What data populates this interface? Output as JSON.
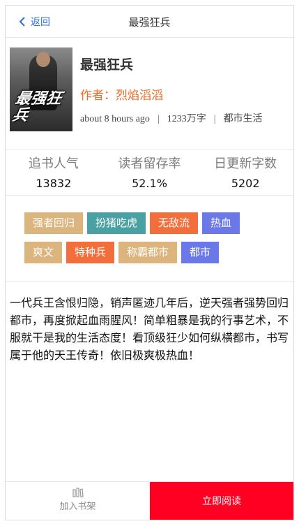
{
  "header": {
    "back_label": "返回",
    "title": "最强狂兵"
  },
  "book": {
    "cover_text": "最强狂兵",
    "title": "最强狂兵",
    "author": "作者：烈焰滔滔",
    "updated": "about 8 hours ago",
    "word_count": "1233万字",
    "category": "都市生活"
  },
  "stats": [
    {
      "label": "追书人气",
      "value": "13832"
    },
    {
      "label": "读者留存率",
      "value": "52.1%"
    },
    {
      "label": "日更新字数",
      "value": "5202"
    }
  ],
  "tags": [
    {
      "label": "强者回归",
      "color": "#dcb47e"
    },
    {
      "label": "扮猪吃虎",
      "color": "#4aa1a3"
    },
    {
      "label": "无敌流",
      "color": "#f26f3b"
    },
    {
      "label": "热血",
      "color": "#6b79e8"
    },
    {
      "label": "爽文",
      "color": "#dcb47e"
    },
    {
      "label": "特种兵",
      "color": "#f26f3b"
    },
    {
      "label": "称霸都市",
      "color": "#dcb47e"
    },
    {
      "label": "都市",
      "color": "#6b79e8"
    }
  ],
  "description": "一代兵王含恨归隐，销声匿迹几年后，逆天强者强势回归都市，再度掀起血雨腥风！简单粗暴是我的行事艺术，不服就干是我的生活态度！看顶级狂少如何纵横都市，书写属于他的天王传奇！依旧极爽极热血！",
  "bottom": {
    "shelf_label": "加入书架",
    "read_label": "立即阅读"
  },
  "colors": {
    "accent_blue": "#2f6fdd",
    "author_orange": "#f06a24",
    "read_red": "#ff0022"
  }
}
